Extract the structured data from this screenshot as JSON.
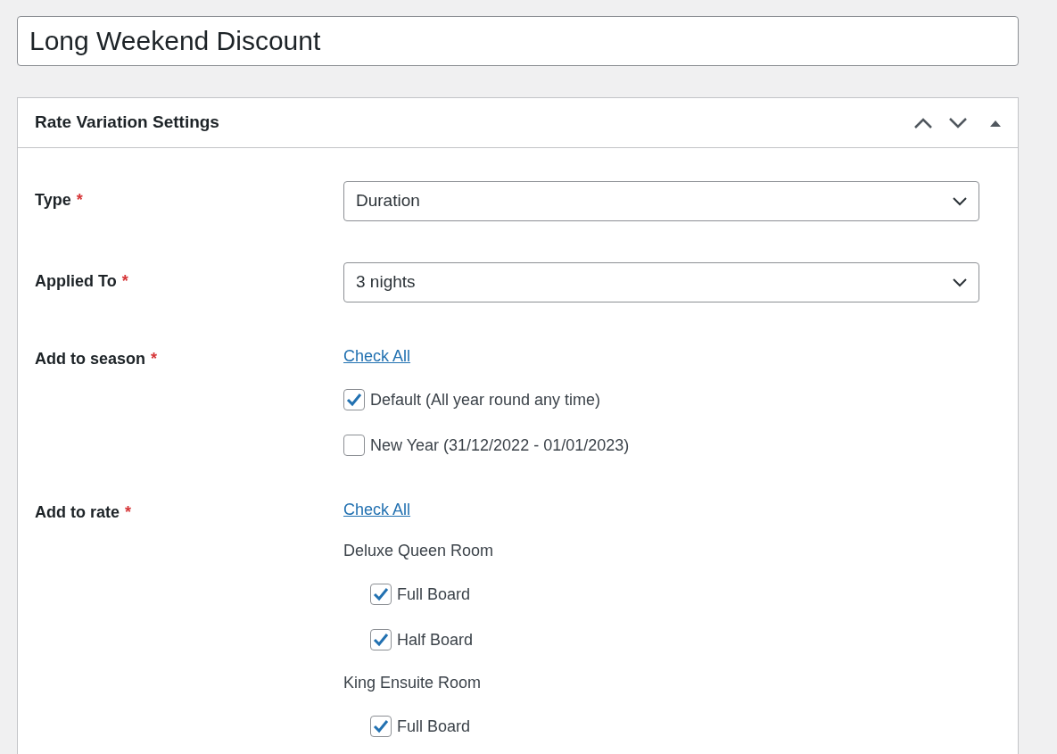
{
  "title_field": {
    "value": "Long Weekend Discount"
  },
  "panel": {
    "title": "Rate Variation Settings",
    "expanded": true
  },
  "fields": [
    {
      "kind": "select",
      "label": "Type",
      "required_mark": "*",
      "value": "Duration"
    },
    {
      "kind": "select",
      "label": "Applied To",
      "required_mark": "*",
      "value": "3 nights"
    },
    {
      "kind": "checklist",
      "label": "Add to season",
      "required_mark": "*",
      "link": "Check All",
      "options": [
        {
          "label": "Default (All year round any time)",
          "checked": true
        },
        {
          "label": "New Year (31/12/2022 - 01/01/2023)",
          "checked": false
        }
      ]
    },
    {
      "kind": "grouped_checklist",
      "label": "Add to rate",
      "required_mark": "*",
      "link": "Check All",
      "groups": [
        {
          "name": "Deluxe Queen Room",
          "options": [
            {
              "label": "Full Board",
              "checked": true
            },
            {
              "label": "Half Board",
              "checked": true
            }
          ]
        },
        {
          "name": "King Ensuite Room",
          "options": [
            {
              "label": "Full Board",
              "checked": true
            }
          ]
        }
      ]
    }
  ]
}
